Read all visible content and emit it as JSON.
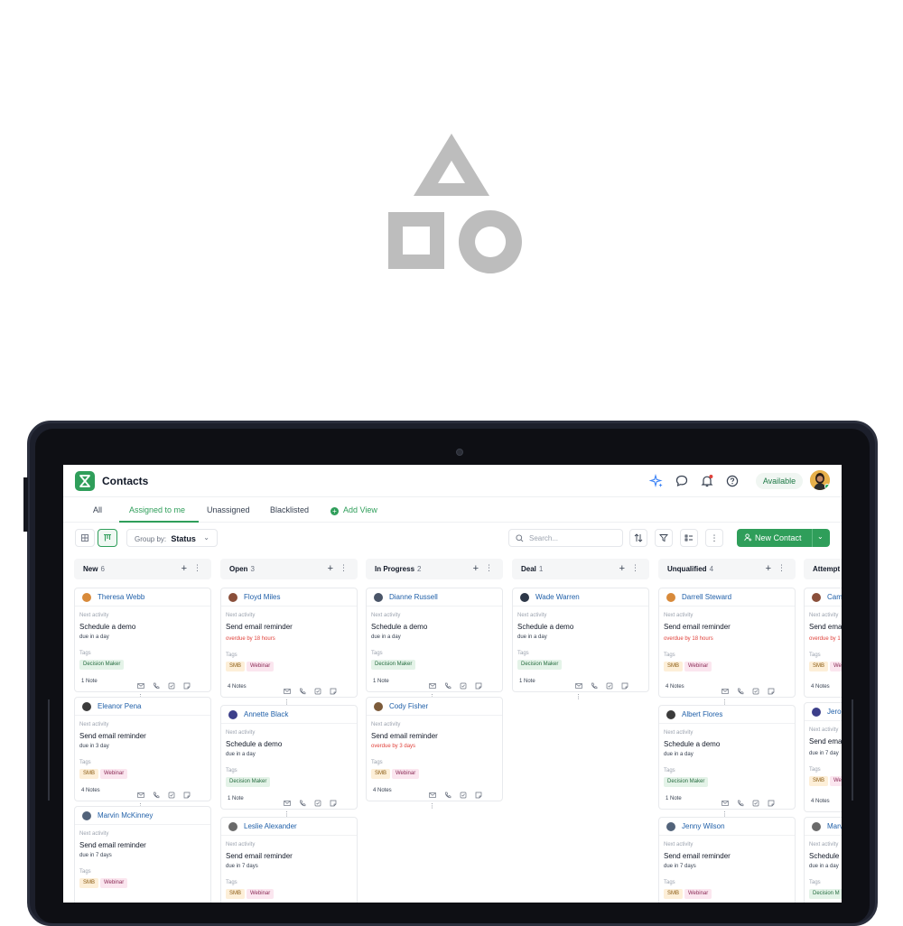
{
  "app": {
    "title": "Contacts",
    "status": "Available"
  },
  "tabs": [
    {
      "label": "All"
    },
    {
      "label": "Assigned to me"
    },
    {
      "label": "Unassigned"
    },
    {
      "label": "Blacklisted"
    },
    {
      "label": "Add View"
    }
  ],
  "toolbar": {
    "group_by_label": "Group by:",
    "group_by_value": "Status",
    "search_placeholder": "Search...",
    "new_contact": "New Contact"
  },
  "columns": [
    {
      "name": "New",
      "count": "6",
      "cards": [
        {
          "name": "Theresa Webb",
          "activity": "Schedule a demo",
          "due": "due in a day",
          "overdue": false,
          "tags": [
            "Decision Maker"
          ],
          "notes": "1 Note"
        },
        {
          "name": "Eleanor Pena",
          "activity": "Send email reminder",
          "due": "due in 3 day",
          "overdue": false,
          "tags": [
            "SMB",
            "Webinar"
          ],
          "notes": "4 Notes"
        },
        {
          "name": "Marvin McKinney",
          "activity": "Send email reminder",
          "due": "due in 7 days",
          "overdue": false,
          "tags": [
            "SMB",
            "Webinar"
          ],
          "notes": ""
        }
      ]
    },
    {
      "name": "Open",
      "count": "3",
      "cards": [
        {
          "name": "Floyd Miles",
          "activity": "Send email reminder",
          "due": "overdue by 18 hours",
          "overdue": true,
          "tags": [
            "SMB",
            "Webinar"
          ],
          "notes": "4 Notes"
        },
        {
          "name": "Annette Black",
          "activity": "Schedule a demo",
          "due": "due in a day",
          "overdue": false,
          "tags": [
            "Decision Maker"
          ],
          "notes": "1 Note"
        },
        {
          "name": "Leslie Alexander",
          "activity": "Send email reminder",
          "due": "due in 7 days",
          "overdue": false,
          "tags": [
            "SMB",
            "Webinar"
          ],
          "notes": ""
        }
      ]
    },
    {
      "name": "In Progress",
      "count": "2",
      "cards": [
        {
          "name": "Dianne Russell",
          "activity": "Schedule a demo",
          "due": "due in a day",
          "overdue": false,
          "tags": [
            "Decision Maker"
          ],
          "notes": "1 Note"
        },
        {
          "name": "Cody Fisher",
          "activity": "Send email reminder",
          "due": "overdue by 3 days",
          "overdue": true,
          "tags": [
            "SMB",
            "Webinar"
          ],
          "notes": "4 Notes"
        }
      ]
    },
    {
      "name": "Deal",
      "count": "1",
      "cards": [
        {
          "name": "Wade Warren",
          "activity": "Schedule a demo",
          "due": "due in a day",
          "overdue": false,
          "tags": [
            "Decision Maker"
          ],
          "notes": "1 Note"
        }
      ]
    },
    {
      "name": "Unqualified",
      "count": "4",
      "cards": [
        {
          "name": "Darrell Steward",
          "activity": "Send email reminder",
          "due": "overdue by 18 hours",
          "overdue": true,
          "tags": [
            "SMB",
            "Webinar"
          ],
          "notes": "4 Notes"
        },
        {
          "name": "Albert Flores",
          "activity": "Schedule a demo",
          "due": "due in a day",
          "overdue": false,
          "tags": [
            "Decision Maker"
          ],
          "notes": "1 Note"
        },
        {
          "name": "Jenny Wilson",
          "activity": "Send email reminder",
          "due": "due in 7 days",
          "overdue": false,
          "tags": [
            "SMB",
            "Webinar"
          ],
          "notes": ""
        }
      ]
    },
    {
      "name": "Attempt",
      "count": "",
      "cards": [
        {
          "name": "Cam",
          "activity": "Send ema",
          "due": "overdue by 1",
          "overdue": true,
          "tags": [
            "SMB",
            "We"
          ],
          "notes": "4 Notes"
        },
        {
          "name": "Jero",
          "activity": "Send ema",
          "due": "due in 7 day",
          "overdue": false,
          "tags": [
            "SMB",
            "We"
          ],
          "notes": "4 Notes"
        },
        {
          "name": "Marv",
          "activity": "Schedule a",
          "due": "due in a day",
          "overdue": false,
          "tags": [
            "Decision M"
          ],
          "notes": ""
        }
      ]
    }
  ],
  "labels": {
    "next_activity": "Next activity",
    "tags": "Tags"
  },
  "colors": {
    "brand": "#2f9e5a",
    "link": "#1f5fa8",
    "overdue": "#e0413a"
  }
}
